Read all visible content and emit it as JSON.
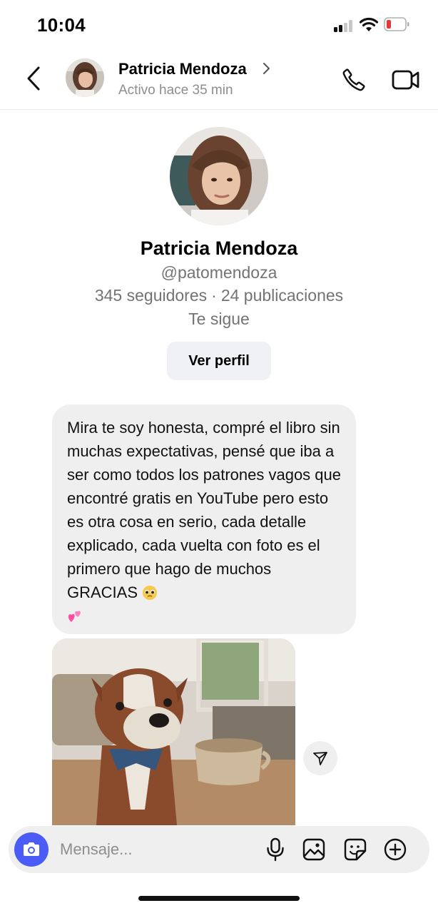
{
  "status_bar": {
    "time": "10:04"
  },
  "header": {
    "contact_name": "Patricia Mendoza",
    "activity": "Activo hace 35 min"
  },
  "profile": {
    "name": "Patricia Mendoza",
    "handle": "@patomendoza",
    "followers": "345 seguidores",
    "separator": "·",
    "posts": "24 publicaciones",
    "follows_you": "Te sigue",
    "view_profile_label": "Ver perfil"
  },
  "messages": [
    {
      "text": "Mira te soy honesta, compré el libro sin muchas expectativas, pensé que iba a ser como todos los patrones vagos que encontré gratis en YouTube pero esto es otra cosa en serio, cada detalle explicado, cada vuelta con foto es el primero que hago de muchos GRACIAS",
      "emojis": [
        "pleading-face",
        "two-hearts"
      ]
    }
  ],
  "composer": {
    "placeholder": "Mensaje..."
  },
  "colors": {
    "accent": "#4a5cf5",
    "bubble": "#efefef",
    "muted_text": "#737373",
    "battery_low": "#e53935"
  }
}
